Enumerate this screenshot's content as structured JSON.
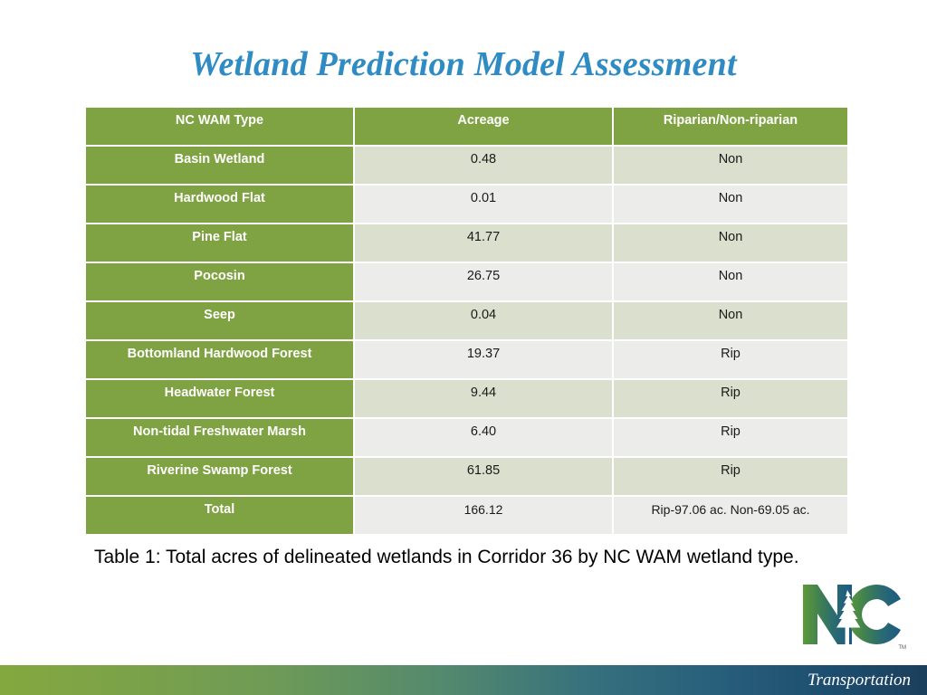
{
  "slide": {
    "title": "Wetland Prediction Model Assessment",
    "title_color": "#2e8bc4",
    "background_color": "#ffffff"
  },
  "table": {
    "header_bg": "#7fa242",
    "row_alt_a_bg": "#dbdfcd",
    "row_alt_b_bg": "#ecedea",
    "columns": [
      "NC WAM Type",
      "Acreage",
      "Riparian/Non-riparian"
    ],
    "rows": [
      {
        "type": "Basin Wetland",
        "acreage": "0.48",
        "riparian": "Non"
      },
      {
        "type": "Hardwood Flat",
        "acreage": "0.01",
        "riparian": "Non"
      },
      {
        "type": "Pine Flat",
        "acreage": "41.77",
        "riparian": "Non"
      },
      {
        "type": "Pocosin",
        "acreage": "26.75",
        "riparian": "Non"
      },
      {
        "type": "Seep",
        "acreage": "0.04",
        "riparian": "Non"
      },
      {
        "type": "Bottomland Hardwood Forest",
        "acreage": "19.37",
        "riparian": "Rip"
      },
      {
        "type": "Headwater Forest",
        "acreage": "9.44",
        "riparian": "Rip"
      },
      {
        "type": "Non-tidal Freshwater Marsh",
        "acreage": "6.40",
        "riparian": "Rip"
      },
      {
        "type": "Riverine Swamp Forest",
        "acreage": "61.85",
        "riparian": "Rip"
      },
      {
        "type": "Total",
        "acreage": "166.12",
        "riparian": "Rip-97.06 ac.  Non-69.05 ac."
      }
    ]
  },
  "caption": {
    "text": "Table 1:  Total acres of delineated wetlands in Corridor 36 by NC WAM wetland type."
  },
  "logo": {
    "name": "nc-logo",
    "letters": "NC",
    "trademark": "TM",
    "green": "#4f8a3d",
    "blue": "#1e5a83"
  },
  "footer": {
    "label": "Transportation",
    "gradient_start": "#84a83f",
    "gradient_end": "#1b3f5c"
  }
}
